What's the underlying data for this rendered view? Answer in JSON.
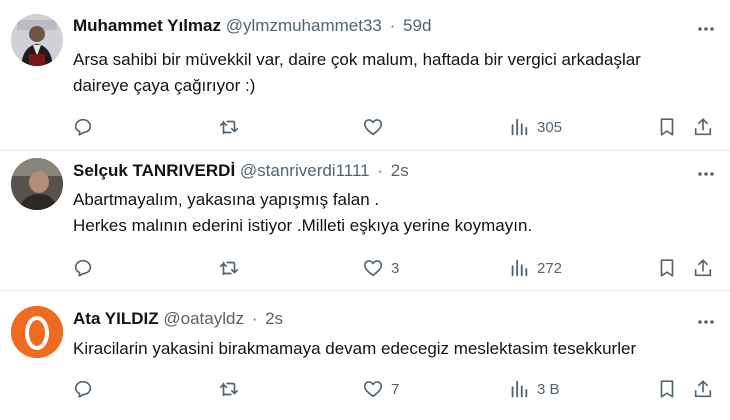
{
  "tweets": [
    {
      "name": "Muhammet Yılmaz",
      "handle": "@ylmzmuhammet33",
      "separator": "·",
      "time": "59d",
      "lines": [
        "Arsa sahibi bir müvekkil var, daire çok malum, haftada bir vergici arkadaşlar",
        "daireye çaya çağırıyor :)"
      ],
      "likes": "",
      "views": "305",
      "icons": [
        "reply-icon",
        "retweet-icon",
        "like-icon",
        "views-icon",
        "bookmark-icon",
        "share-icon"
      ]
    },
    {
      "name": "Selçuk TANRIVERDİ",
      "handle": "@stanriverdi1111",
      "separator": "·",
      "time": "2s",
      "lines": [
        "Abartmayalım, yakasına yapışmış falan .",
        "Herkes malının ederini istiyor .Milleti eşkıya yerine koymayın."
      ],
      "likes": "3",
      "views": "272",
      "icons": [
        "reply-icon",
        "retweet-icon",
        "like-icon",
        "views-icon",
        "bookmark-icon",
        "share-icon"
      ]
    },
    {
      "name": "Ata YILDIZ",
      "handle": "@oatayldz",
      "separator": "·",
      "time": "2s",
      "lines": [
        "Kiracilarin yakasini birakmamaya devam edecegiz meslektasim tesekkurler"
      ],
      "likes": "7",
      "views": "3 B",
      "icons": [
        "reply-icon",
        "retweet-icon",
        "like-icon",
        "views-icon",
        "bookmark-icon",
        "share-icon"
      ]
    }
  ],
  "colors": {
    "text": "#0f1419",
    "secondary": "#536471",
    "divider": "#e6e9ec",
    "avatar_orange": "#f06a1f"
  }
}
